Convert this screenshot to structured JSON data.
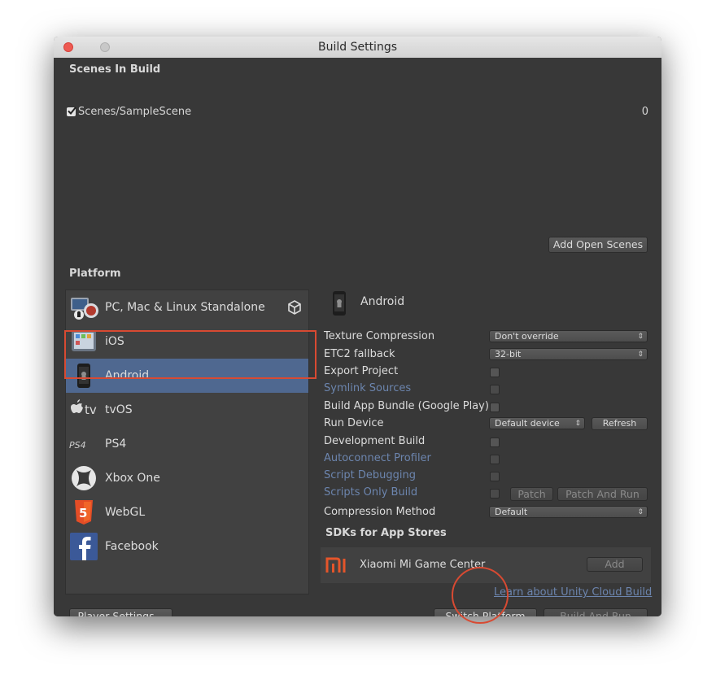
{
  "window": {
    "title": "Build Settings"
  },
  "scenes": {
    "header": "Scenes In Build",
    "items": [
      {
        "name": "Scenes/SampleScene",
        "checked": true,
        "index": "0"
      }
    ],
    "add_open_scenes_label": "Add Open Scenes"
  },
  "platform": {
    "header": "Platform",
    "items": [
      {
        "label": "PC, Mac & Linux Standalone",
        "icon": "pc-mac-linux-icon"
      },
      {
        "label": "iOS",
        "icon": "ios-icon"
      },
      {
        "label": "Android",
        "icon": "android-icon",
        "selected": true
      },
      {
        "label": "tvOS",
        "icon": "tvos-icon"
      },
      {
        "label": "PS4",
        "icon": "ps4-icon"
      },
      {
        "label": "Xbox One",
        "icon": "xbox-icon"
      },
      {
        "label": "WebGL",
        "icon": "html5-icon"
      },
      {
        "label": "Facebook",
        "icon": "facebook-icon"
      }
    ]
  },
  "android_settings": {
    "title": "Android",
    "texture_compression": {
      "label": "Texture Compression",
      "value": "Don't override"
    },
    "etc2_fallback": {
      "label": "ETC2 fallback",
      "value": "32-bit"
    },
    "export_project": {
      "label": "Export Project"
    },
    "symlink_sources": {
      "label": "Symlink Sources"
    },
    "build_app_bundle": {
      "label": "Build App Bundle (Google Play)"
    },
    "run_device": {
      "label": "Run Device",
      "value": "Default device",
      "refresh_label": "Refresh"
    },
    "development_build": {
      "label": "Development Build"
    },
    "autoconnect_profiler": {
      "label": "Autoconnect Profiler"
    },
    "script_debugging": {
      "label": "Script Debugging"
    },
    "scripts_only_build": {
      "label": "Scripts Only Build",
      "patch_label": "Patch",
      "patch_and_run_label": "Patch And Run"
    },
    "compression_method": {
      "label": "Compression Method",
      "value": "Default"
    }
  },
  "sdks": {
    "header": "SDKs for App Stores",
    "items": [
      {
        "logo_text": "MI",
        "name": "Xiaomi Mi Game Center",
        "add_label": "Add"
      }
    ]
  },
  "footer": {
    "cloud_build_link": "Learn about Unity Cloud Build",
    "player_settings_label": "Player Settings...",
    "switch_platform_label": "Switch Platform",
    "build_and_run_label": "Build And Run"
  },
  "colors": {
    "selection": "#4f6890",
    "annotation": "#d84a32",
    "link": "#6c85ae",
    "background": "#383838"
  }
}
